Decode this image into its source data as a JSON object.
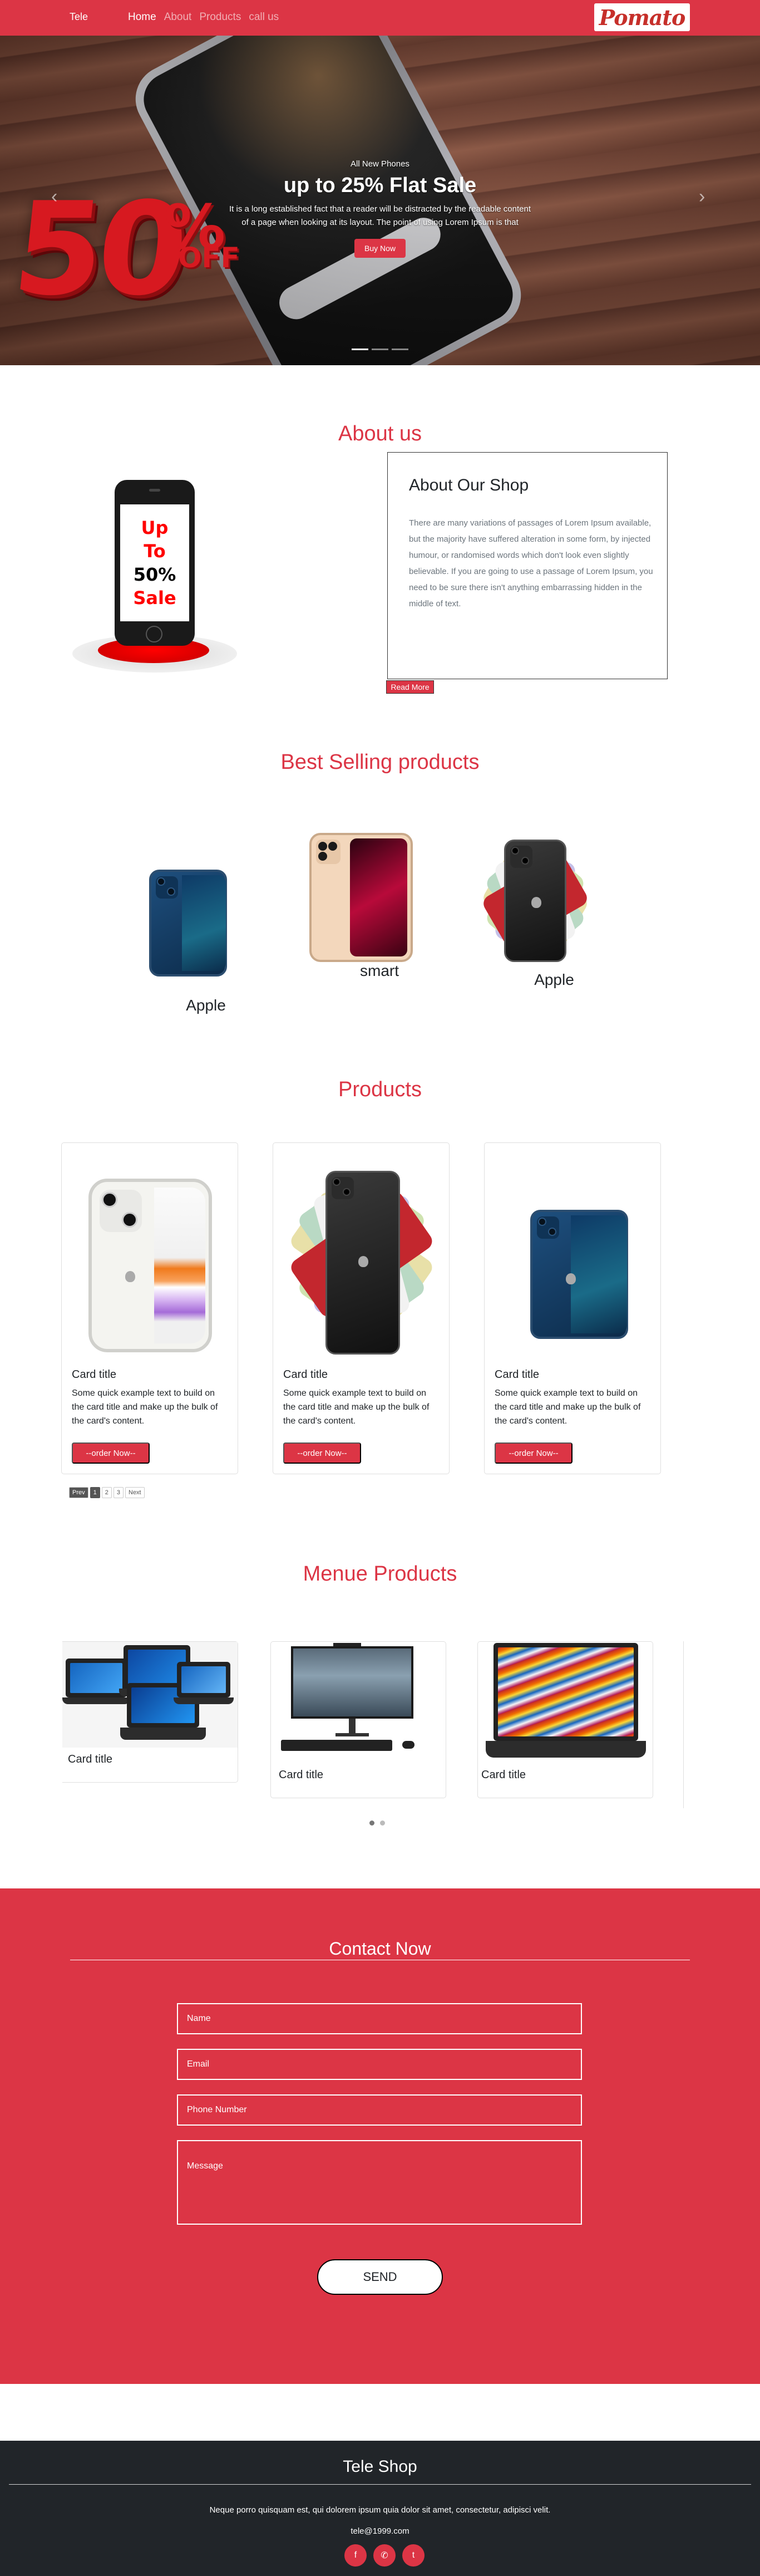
{
  "nav": {
    "brand": "Tele",
    "links": [
      "Home",
      "About",
      "Products",
      "call us"
    ],
    "logo": "Pomato"
  },
  "hero": {
    "badge_big": "50",
    "badge_percent": "%",
    "badge_off": "OFF",
    "eyebrow": "All New Phones",
    "title": "up to 25% Flat Sale",
    "text_line1": "It is a long established fact that a reader will be distracted by the readable content",
    "text_line2": "of a page when looking at its layout. The point of using Lorem Ipsum is that",
    "button": "Buy Now",
    "prev_arrow": "‹",
    "next_arrow": "›"
  },
  "about": {
    "heading": "About us",
    "promo": [
      "Up",
      "To",
      "50%",
      "Sale"
    ],
    "card_title": "About Our Shop",
    "card_text": "There are many variations of passages of Lorem Ipsum available, but the majority have suffered alteration in some form, by injected humour, or randomised words which don't look even slightly believable. If you are going to use a passage of Lorem Ipsum, you need to be sure there isn't anything embarrassing hidden in the middle of text.",
    "read_more": "Read More"
  },
  "best_selling": {
    "heading": "Best Selling products",
    "items": [
      {
        "label": "Apple"
      },
      {
        "label": "smart"
      },
      {
        "label": "Apple"
      }
    ]
  },
  "products": {
    "heading": "Products",
    "cards": [
      {
        "title": "Card title",
        "text": "Some quick example text to build on the card title and make up the bulk of the card's content.",
        "button": "--order Now--"
      },
      {
        "title": "Card title",
        "text": "Some quick example text to build on the card title and make up the bulk of the card's content.",
        "button": "--order Now--"
      },
      {
        "title": "Card title",
        "text": "Some quick example text to build on the card title and make up the bulk of the card's content.",
        "button": "--order Now--"
      }
    ],
    "pager": [
      "Prev",
      "1",
      "2",
      "3",
      "Next"
    ]
  },
  "menue": {
    "heading": "Menue Products",
    "cards": [
      {
        "title": "Card title"
      },
      {
        "title": "Card title"
      },
      {
        "title": "Card title"
      }
    ]
  },
  "contact": {
    "heading": "Contact Now",
    "name_placeholder": "Name",
    "email_placeholder": "Email",
    "phone_placeholder": "Phone Number",
    "message_placeholder": "Message",
    "send": "SEND"
  },
  "footer": {
    "title": "Tele Shop",
    "text": "Neque porro quisquam est, qui dolorem ipsum quia dolor sit amet, consectetur, adipisci velit.",
    "email": "tele@1999.com",
    "socials": [
      "f",
      "✆",
      "t"
    ]
  },
  "colors": {
    "brand_red": "#dc3545",
    "footer_dark": "#212529"
  },
  "icons": [
    "carousel-prev-icon",
    "carousel-next-icon",
    "facebook-icon",
    "phone-icon",
    "twitter-icon"
  ]
}
